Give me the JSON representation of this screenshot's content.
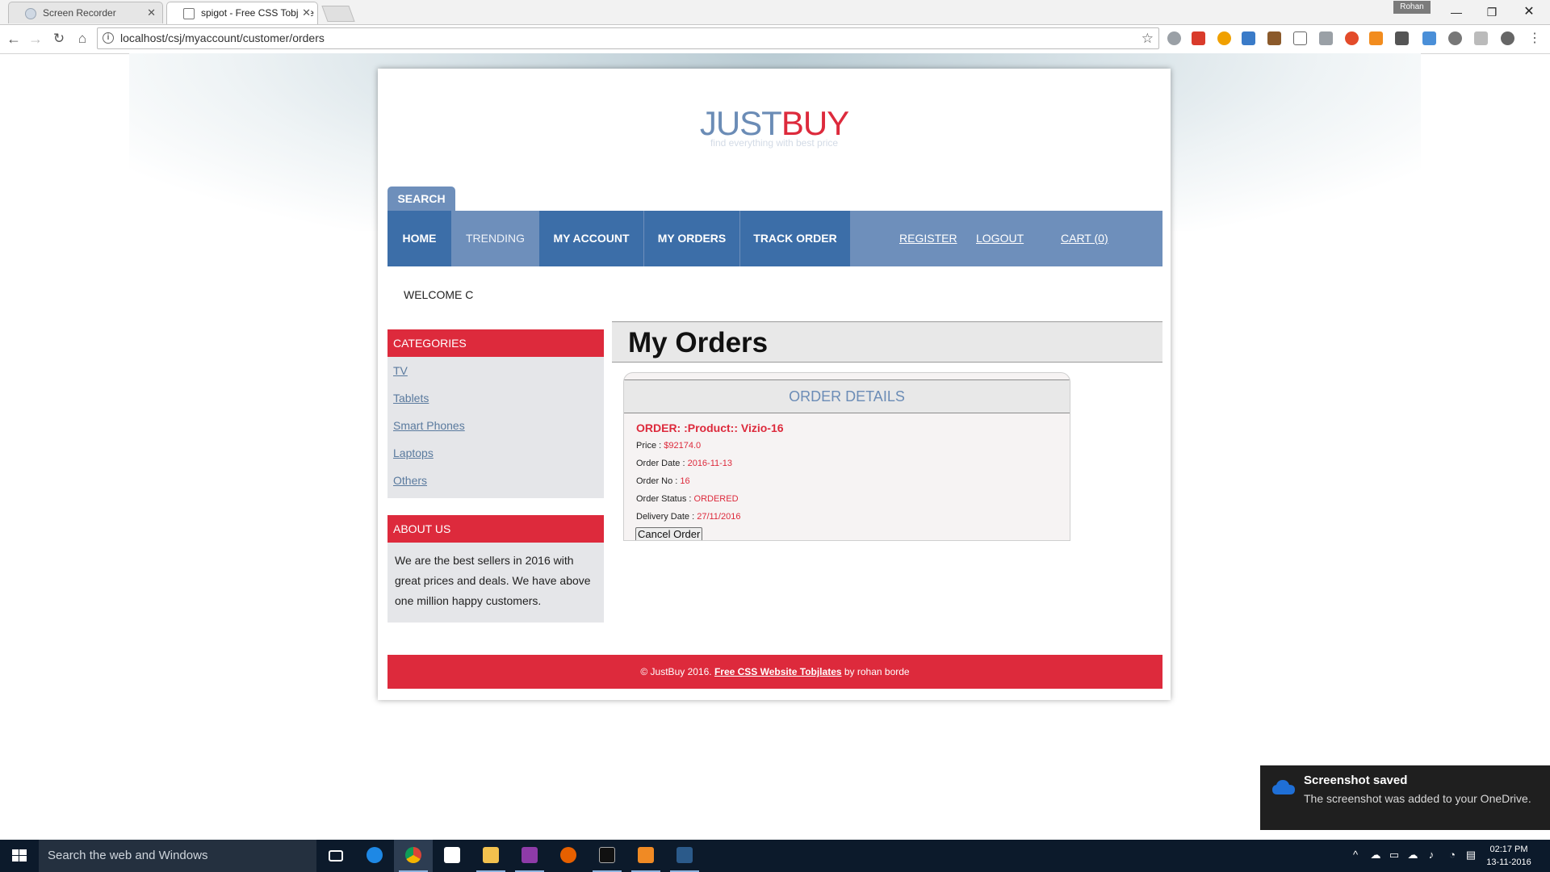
{
  "browser": {
    "tabs": [
      {
        "label": "Screen Recorder",
        "active": false
      },
      {
        "label": "spigot - Free CSS Tobjlate",
        "active": true
      }
    ],
    "user_badge": "Rohan",
    "url": "localhost/csj/myaccount/customer/orders"
  },
  "site": {
    "logo_part1": "JUST",
    "logo_part2": "BUY",
    "tagline": "find everything with best price",
    "search_tab": "SEARCH",
    "menu": {
      "home": "HOME",
      "trending": "TRENDING",
      "my_account": "MY ACCOUNT",
      "my_orders": "MY ORDERS",
      "track_order": "TRACK ORDER",
      "register": "REGISTER",
      "logout": "LOGOUT",
      "cart": "CART (0)"
    },
    "welcome": "WELCOME C",
    "categories": {
      "heading": "CATEGORIES",
      "items": [
        "TV",
        "Tablets",
        "Smart Phones",
        "Laptops",
        "Others"
      ]
    },
    "about": {
      "heading": "ABOUT US",
      "text": "We are the best sellers in 2016 with great prices and deals. We have above one million happy customers."
    },
    "orders": {
      "page_title": "My Orders",
      "card_heading": "ORDER DETAILS",
      "order_title": "ORDER: :Product:: Vizio-16",
      "price_label": "Price : ",
      "price_value": "$92174.0",
      "date_label": "Order Date : ",
      "date_value": "2016-11-13",
      "no_label": "Order No : ",
      "no_value": "16",
      "status_label": "Order Status : ",
      "status_value": "ORDERED",
      "delivery_label": "Delivery Date : ",
      "delivery_value": "27/11/2016",
      "cancel_button": "Cancel Order"
    },
    "footer": {
      "prefix": "© JustBuy 2016. ",
      "link": "Free CSS Website Tobjlates",
      "suffix": " by rohan borde"
    }
  },
  "notification": {
    "title": "Screenshot saved",
    "body": "The screenshot was added to your OneDrive."
  },
  "taskbar": {
    "search_placeholder": "Search the web and Windows",
    "time": "02:17 PM",
    "date": "13-11-2016"
  },
  "colors": {
    "brand_blue": "#6e8fbb",
    "menu_dark_blue": "#3c6ea8",
    "brand_red": "#dd2a3c"
  }
}
